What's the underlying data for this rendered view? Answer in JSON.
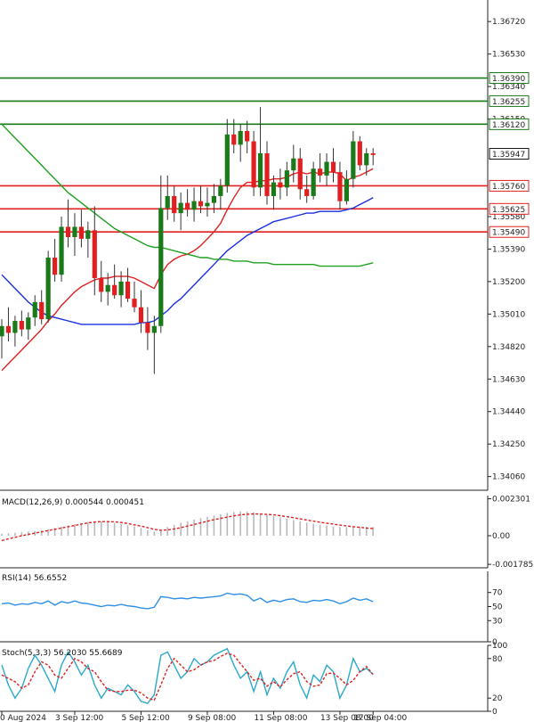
{
  "chart_data": [
    {
      "type": "candlestick",
      "title": "",
      "ylim": [
        1.3398,
        1.3682
      ],
      "y_ticks": [
        "1.36720",
        "1.36530",
        "1.36340",
        "1.36150",
        "1.35580",
        "1.35390",
        "1.35200",
        "1.35010",
        "1.34820",
        "1.34630",
        "1.34440",
        "1.34250",
        "1.34060"
      ],
      "last_price": "1.35947",
      "levels": [
        {
          "label": "1.36390",
          "value": 1.3639,
          "color": "#1a7a1a"
        },
        {
          "label": "1.36255",
          "value": 1.36255,
          "color": "#1a7a1a"
        },
        {
          "label": "1.36120",
          "value": 1.3612,
          "color": "#1a7a1a"
        },
        {
          "label": "1.35760",
          "value": 1.3576,
          "color": "#e02020"
        },
        {
          "label": "1.35625",
          "value": 1.35625,
          "color": "#e02020"
        },
        {
          "label": "1.35490",
          "value": 1.3549,
          "color": "#e02020"
        }
      ],
      "candles": [
        [
          1.3488,
          1.3498,
          1.3475,
          1.3494
        ],
        [
          1.3494,
          1.3505,
          1.3485,
          1.349
        ],
        [
          1.349,
          1.35,
          1.3482,
          1.3497
        ],
        [
          1.3497,
          1.3503,
          1.3488,
          1.3492
        ],
        [
          1.3492,
          1.3502,
          1.3486,
          1.3499
        ],
        [
          1.3499,
          1.3512,
          1.3494,
          1.3508
        ],
        [
          1.3508,
          1.3515,
          1.3495,
          1.3498
        ],
        [
          1.3498,
          1.3538,
          1.3496,
          1.3534
        ],
        [
          1.3534,
          1.3545,
          1.352,
          1.3524
        ],
        [
          1.3524,
          1.3558,
          1.352,
          1.3552
        ],
        [
          1.3552,
          1.3568,
          1.354,
          1.3546
        ],
        [
          1.3546,
          1.356,
          1.3535,
          1.3552
        ],
        [
          1.3552,
          1.3562,
          1.354,
          1.3545
        ],
        [
          1.3545,
          1.3555,
          1.3534,
          1.355
        ],
        [
          1.355,
          1.3564,
          1.3512,
          1.3522
        ],
        [
          1.3522,
          1.3532,
          1.3508,
          1.3514
        ],
        [
          1.3514,
          1.3525,
          1.3506,
          1.3518
        ],
        [
          1.3518,
          1.353,
          1.351,
          1.3512
        ],
        [
          1.3512,
          1.3526,
          1.3505,
          1.352
        ],
        [
          1.352,
          1.3528,
          1.3508,
          1.351
        ],
        [
          1.351,
          1.352,
          1.3502,
          1.3505
        ],
        [
          1.3505,
          1.3515,
          1.349,
          1.3496
        ],
        [
          1.3496,
          1.3505,
          1.348,
          1.349
        ],
        [
          1.349,
          1.35,
          1.3466,
          1.3494
        ],
        [
          1.3494,
          1.3582,
          1.349,
          1.3563
        ],
        [
          1.3563,
          1.3582,
          1.3556,
          1.357
        ],
        [
          1.357,
          1.3576,
          1.3555,
          1.356
        ],
        [
          1.356,
          1.3572,
          1.355,
          1.3566
        ],
        [
          1.3566,
          1.3574,
          1.3558,
          1.3562
        ],
        [
          1.3562,
          1.3575,
          1.3555,
          1.3567
        ],
        [
          1.3567,
          1.3576,
          1.356,
          1.3564
        ],
        [
          1.3564,
          1.3575,
          1.3558,
          1.3566
        ],
        [
          1.3566,
          1.3577,
          1.356,
          1.357
        ],
        [
          1.357,
          1.358,
          1.3562,
          1.3576
        ],
        [
          1.3576,
          1.3615,
          1.3572,
          1.3606
        ],
        [
          1.3606,
          1.3615,
          1.3595,
          1.36
        ],
        [
          1.36,
          1.3612,
          1.359,
          1.3608
        ],
        [
          1.3608,
          1.3614,
          1.3595,
          1.3602
        ],
        [
          1.3602,
          1.3608,
          1.357,
          1.3575
        ],
        [
          1.3575,
          1.3622,
          1.357,
          1.3595
        ],
        [
          1.3595,
          1.3602,
          1.3565,
          1.357
        ],
        [
          1.357,
          1.3582,
          1.3562,
          1.3578
        ],
        [
          1.3578,
          1.3586,
          1.3568,
          1.3575
        ],
        [
          1.3575,
          1.359,
          1.357,
          1.3585
        ],
        [
          1.3585,
          1.36,
          1.3578,
          1.3592
        ],
        [
          1.3592,
          1.3598,
          1.3568,
          1.3574
        ],
        [
          1.3574,
          1.3582,
          1.3566,
          1.357
        ],
        [
          1.357,
          1.359,
          1.3568,
          1.3586
        ],
        [
          1.3586,
          1.3595,
          1.3578,
          1.3582
        ],
        [
          1.3582,
          1.3595,
          1.3576,
          1.359
        ],
        [
          1.359,
          1.3598,
          1.3578,
          1.3584
        ],
        [
          1.3584,
          1.359,
          1.3562,
          1.3567
        ],
        [
          1.3567,
          1.3585,
          1.3565,
          1.358
        ],
        [
          1.358,
          1.3608,
          1.3575,
          1.3602
        ],
        [
          1.3602,
          1.3605,
          1.3585,
          1.3588
        ],
        [
          1.3588,
          1.3598,
          1.3582,
          1.3595
        ],
        [
          1.3595,
          1.3598,
          1.3588,
          1.3594
        ]
      ],
      "moving_averages": [
        {
          "color": "#e02020",
          "values": [
            1.3468,
            1.3472,
            1.3476,
            1.348,
            1.3484,
            1.3488,
            1.3492,
            1.3497,
            1.3501,
            1.3506,
            1.351,
            1.3514,
            1.3517,
            1.3519,
            1.3521,
            1.3522,
            1.3522,
            1.3523,
            1.3523,
            1.3523,
            1.3522,
            1.352,
            1.3518,
            1.3516,
            1.3524,
            1.353,
            1.3533,
            1.3535,
            1.3536,
            1.3538,
            1.3541,
            1.3545,
            1.3549,
            1.3554,
            1.3562,
            1.3569,
            1.3575,
            1.3578,
            1.3578,
            1.3579,
            1.3579,
            1.358,
            1.358,
            1.3581,
            1.3583,
            1.3584,
            1.3583,
            1.3584,
            1.3583,
            1.3584,
            1.3584,
            1.3583,
            1.3579,
            1.3581,
            1.3582,
            1.3584,
            1.3586
          ]
        },
        {
          "color": "#1a2fe0",
          "values": [
            1.3524,
            1.352,
            1.3516,
            1.3512,
            1.3508,
            1.3505,
            1.3502,
            1.35,
            1.3499,
            1.3498,
            1.3497,
            1.3496,
            1.3495,
            1.3495,
            1.3495,
            1.3495,
            1.3495,
            1.3495,
            1.3495,
            1.3495,
            1.3495,
            1.3496,
            1.3496,
            1.3497,
            1.35,
            1.3503,
            1.3507,
            1.351,
            1.3514,
            1.3518,
            1.3522,
            1.3526,
            1.353,
            1.3534,
            1.3538,
            1.3541,
            1.3544,
            1.3547,
            1.3549,
            1.3551,
            1.3553,
            1.3555,
            1.3556,
            1.3557,
            1.3558,
            1.3559,
            1.356,
            1.356,
            1.3561,
            1.3561,
            1.3561,
            1.3561,
            1.3562,
            1.3563,
            1.3565,
            1.3567,
            1.3569
          ]
        },
        {
          "color": "#20a020",
          "values": [
            1.3612,
            1.3608,
            1.3604,
            1.36,
            1.3596,
            1.3592,
            1.3588,
            1.3584,
            1.358,
            1.3576,
            1.3572,
            1.3569,
            1.3566,
            1.3563,
            1.356,
            1.3557,
            1.3554,
            1.3551,
            1.3549,
            1.3547,
            1.3545,
            1.3543,
            1.3541,
            1.354,
            1.354,
            1.3539,
            1.3538,
            1.3537,
            1.3536,
            1.3535,
            1.3534,
            1.3534,
            1.3533,
            1.3533,
            1.3533,
            1.3532,
            1.3532,
            1.3532,
            1.3531,
            1.3531,
            1.3531,
            1.353,
            1.353,
            1.353,
            1.353,
            1.353,
            1.353,
            1.353,
            1.3529,
            1.3529,
            1.3529,
            1.3529,
            1.3529,
            1.3529,
            1.3529,
            1.353,
            1.3531
          ]
        }
      ]
    },
    {
      "type": "bar",
      "title": "MACD(12,26,9) 0.000544 0.000451",
      "ylim": [
        -0.002,
        0.0025
      ],
      "y_ticks": [
        "0.002301",
        "0.00",
        "-0.001785"
      ],
      "values": [
        0.00012,
        0.00015,
        0.00018,
        0.00022,
        0.00025,
        0.0003,
        0.00034,
        0.0004,
        0.00048,
        0.00055,
        0.00064,
        0.00072,
        0.0008,
        0.00086,
        0.0009,
        0.00088,
        0.00085,
        0.0008,
        0.00074,
        0.00066,
        0.00058,
        0.00048,
        0.00036,
        0.00025,
        0.00038,
        0.00054,
        0.00068,
        0.0008,
        0.0009,
        0.001,
        0.0011,
        0.00118,
        0.00126,
        0.00134,
        0.00142,
        0.00148,
        0.00152,
        0.0015,
        0.00145,
        0.00138,
        0.0013,
        0.00122,
        0.00114,
        0.00106,
        0.00098,
        0.0009,
        0.00082,
        0.00075,
        0.00068,
        0.00063,
        0.00058,
        0.00054,
        0.00052,
        0.00055,
        0.00056,
        0.00055,
        0.00054
      ],
      "signal": [
        -0.0003,
        -0.0002,
        -0.0001,
        0.0,
        8e-05,
        0.00016,
        0.00024,
        0.00032,
        0.0004,
        0.00048,
        0.00056,
        0.00064,
        0.00072,
        0.0008,
        0.00085,
        0.00088,
        0.00088,
        0.00086,
        0.00082,
        0.00076,
        0.00068,
        0.0006,
        0.0005,
        0.0004,
        0.00034,
        0.00036,
        0.00042,
        0.0005,
        0.0006,
        0.0007,
        0.0008,
        0.0009,
        0.001,
        0.00108,
        0.00116,
        0.00124,
        0.0013,
        0.00134,
        0.00136,
        0.00135,
        0.00133,
        0.0013,
        0.00125,
        0.00119,
        0.00112,
        0.00105,
        0.00098,
        0.00091,
        0.00084,
        0.00078,
        0.00072,
        0.00066,
        0.00061,
        0.00056,
        0.00052,
        0.00048,
        0.00045
      ]
    },
    {
      "type": "line",
      "title": "RSI(14) 56.6552",
      "ylim": [
        0,
        100
      ],
      "y_ticks": [
        "70",
        "50",
        "30",
        "0"
      ],
      "values": [
        54,
        55,
        52,
        54,
        53,
        56,
        54,
        58,
        52,
        57,
        55,
        58,
        55,
        54,
        52,
        50,
        52,
        51,
        53,
        51,
        50,
        48,
        47,
        49,
        64,
        63,
        61,
        62,
        61,
        63,
        62,
        63,
        64,
        65,
        69,
        67,
        68,
        66,
        58,
        62,
        56,
        59,
        57,
        60,
        61,
        57,
        56,
        59,
        58,
        60,
        58,
        54,
        57,
        62,
        59,
        61,
        57
      ]
    },
    {
      "type": "line",
      "title": "Stoch(5,3,3) 56.2030 55.6689",
      "ylim": [
        0,
        100
      ],
      "y_ticks": [
        "100",
        "80",
        "20",
        "0"
      ],
      "k": [
        70,
        40,
        20,
        35,
        65,
        85,
        70,
        50,
        30,
        70,
        90,
        75,
        55,
        70,
        40,
        20,
        35,
        30,
        25,
        40,
        30,
        15,
        12,
        25,
        85,
        90,
        70,
        50,
        60,
        80,
        70,
        75,
        85,
        90,
        95,
        70,
        50,
        60,
        30,
        60,
        25,
        50,
        35,
        60,
        75,
        40,
        20,
        55,
        45,
        70,
        60,
        20,
        40,
        80,
        60,
        65,
        56
      ],
      "d": [
        55,
        50,
        45,
        35,
        40,
        60,
        75,
        70,
        55,
        50,
        65,
        80,
        75,
        65,
        60,
        45,
        32,
        30,
        30,
        32,
        32,
        28,
        20,
        17,
        40,
        65,
        80,
        70,
        60,
        63,
        70,
        75,
        77,
        83,
        88,
        85,
        72,
        60,
        47,
        50,
        38,
        45,
        37,
        48,
        57,
        60,
        45,
        38,
        40,
        57,
        58,
        50,
        40,
        47,
        60,
        68,
        56
      ]
    }
  ],
  "x_labels": [
    {
      "label": "0 Aug 2024",
      "index": 0
    },
    {
      "label": "3 Sep 12:00",
      "index": 11
    },
    {
      "label": "5 Sep 12:00",
      "index": 21
    },
    {
      "label": "9 Sep 08:00",
      "index": 31
    },
    {
      "label": "11 Sep 08:00",
      "index": 41
    },
    {
      "label": "13 Sep 08:00",
      "index": 51
    },
    {
      "label": "17 Sep 04:00",
      "index": 56
    }
  ],
  "colors": {
    "up": "#1a7a1a",
    "down": "#e02020",
    "grid": "#d8d8d8",
    "axis": "#222222"
  }
}
